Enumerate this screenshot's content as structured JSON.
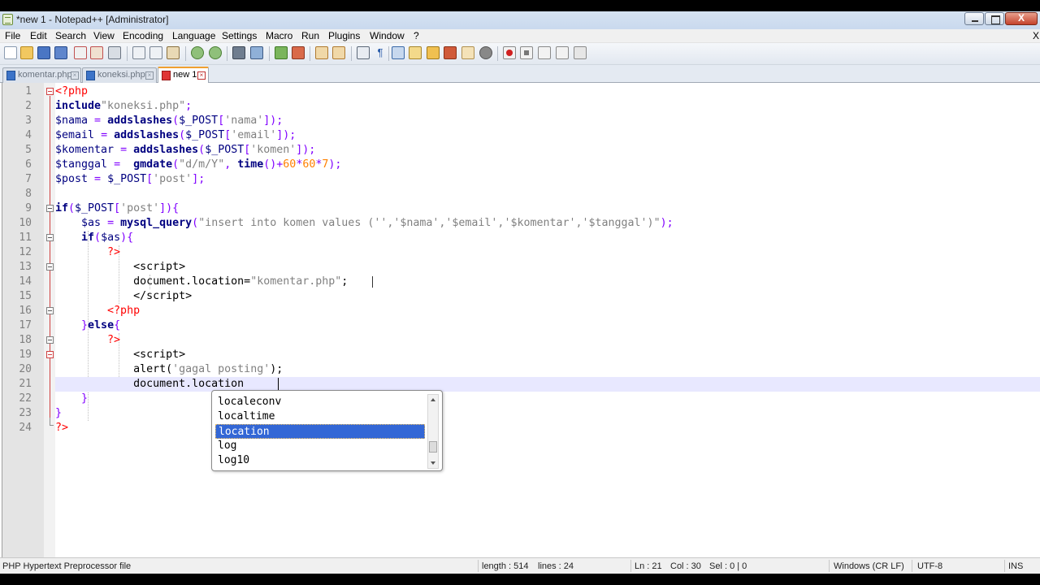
{
  "window": {
    "title": "*new 1 - Notepad++ [Administrator]",
    "close_glyph": "X"
  },
  "menu": {
    "items": [
      "File",
      "Edit",
      "Search",
      "View",
      "Encoding",
      "Language",
      "Settings",
      "Macro",
      "Run",
      "Plugins",
      "Window",
      "?"
    ],
    "close": "X"
  },
  "toolbar": {
    "icons": [
      "new-file-icon",
      "open-file-icon",
      "save-icon",
      "save-all-icon",
      "close-icon",
      "close-all-icon",
      "print-icon",
      "cut-icon",
      "copy-icon",
      "paste-icon",
      "undo-icon",
      "redo-icon",
      "find-icon",
      "replace-icon",
      "zoom-in-icon",
      "zoom-out-icon",
      "sync-vertical-icon",
      "sync-horizontal-icon",
      "word-wrap-icon",
      "show-all-chars-icon",
      "indent-guide-icon",
      "udl-icon",
      "doc-map-icon",
      "function-list-icon",
      "folder-workspace-icon",
      "monitoring-icon",
      "record-macro-icon",
      "stop-macro-icon",
      "play-macro-icon",
      "run-macro-multiple-icon",
      "save-macro-icon"
    ]
  },
  "tabs": [
    {
      "label": "komentar.php",
      "active": false
    },
    {
      "label": "koneksi.php",
      "active": false
    },
    {
      "label": "new 1",
      "active": true
    }
  ],
  "editor": {
    "line_numbers": [
      "1",
      "2",
      "3",
      "4",
      "5",
      "6",
      "7",
      "8",
      "9",
      "10",
      "11",
      "12",
      "13",
      "14",
      "15",
      "16",
      "17",
      "18",
      "19",
      "20",
      "21",
      "22",
      "23",
      "24"
    ],
    "current_line": 21
  },
  "autocomplete": {
    "items": [
      "localeconv",
      "localtime",
      "location",
      "log",
      "log10"
    ],
    "selected": "location"
  },
  "status": {
    "filetype": "PHP Hypertext Preprocessor file",
    "length": "length : 514",
    "lines": "lines : 24",
    "ln": "Ln : 21",
    "col": "Col : 30",
    "sel": "Sel : 0 | 0",
    "eol": "Windows (CR LF)",
    "encoding": "UTF-8",
    "mode": "INS"
  },
  "colors": {
    "keyword": "#000080",
    "string": "#808080",
    "operator": "#8000ff",
    "number": "#ff8000",
    "php_tag": "#ff0000",
    "current_line": "#e8e8ff",
    "selection": "#3367d6"
  }
}
